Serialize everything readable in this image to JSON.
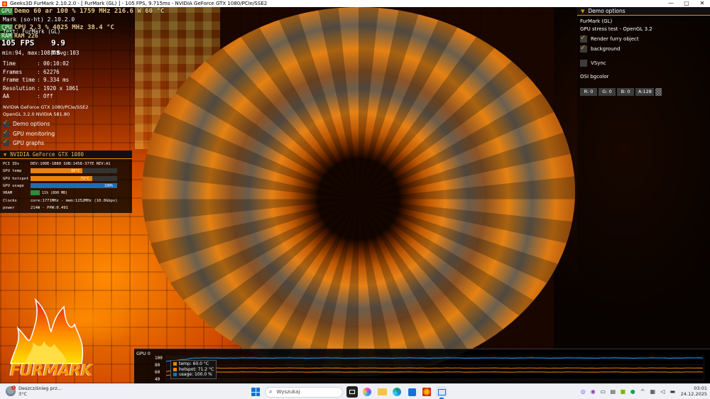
{
  "window": {
    "title": "Geeks3D FurMark 2.10.2.0 - [ FurMark (GL) ] - 105 FPS, 9.715ms - NVIDIA GeForce GTX 1080/PCIe/SSE2",
    "minimize": "—",
    "maximize": "▢",
    "close": "✕"
  },
  "osd": {
    "line1": "Demo 60 ar  100 %  1759 MHz 216.6 W   60 °C",
    "line2": "Mark (so-ht) 2.10.2.0",
    "line3": "CPU  2.3 %  4025 MHz  38.4 °C",
    "line4": "Test: FurMark (GL)",
    "ram": "RAM 226",
    "badge_gpu": "GPU",
    "badge_cpu": "CPU",
    "badge_ram": "RAM",
    "fps": "105 FPS",
    "frame_ms": "9.9 ms",
    "minmax": "min:94, max:108, avg:103"
  },
  "stats": [
    {
      "k": "Time",
      "v": ": 00:10:02"
    },
    {
      "k": "Frames",
      "v": ": 62276"
    },
    {
      "k": "Frame time",
      "v": ": 9.334 ms"
    },
    {
      "k": "Resolution",
      "v": ": 1920 x 1061"
    },
    {
      "k": "AA",
      "v": ": Off"
    }
  ],
  "gpu_info": {
    "renderer": "NVIDIA GeForce GTX 1080/PCIe/SSE2",
    "opengl": "OpenGL 3.2.0 NVIDIA 581.80"
  },
  "left_options": [
    {
      "label": "Demo options",
      "checked": true
    },
    {
      "label": "GPU monitoring",
      "checked": true
    },
    {
      "label": "GPU graphs",
      "checked": true
    }
  ],
  "gpu_panel": {
    "title": "NVIDIA GeForce GTX 1080",
    "pci_label": "PCI IDs",
    "pci_value": "DEV:10DE-1B80 SUB:1458-377E REV:A1",
    "temp_label": "GPU temp",
    "temp_value": "60°C",
    "temp_frac": 0.6,
    "hotspot_label": "GPU hotspot",
    "hotspot_value": "71°C",
    "hotspot_frac": 0.71,
    "usage_label": "GPU usage",
    "usage_value": "100%",
    "usage_frac": 1.0,
    "vram_label": "VRAM",
    "vram_value": "11% (890 MB)",
    "vram_frac": 0.11,
    "clocks_label": "Clocks",
    "clocks_value": "core:1771MHz - mem:1252MHz (10.0Gbps)",
    "power_label": "power",
    "power_value": "214W - PPW:0.491",
    "colors": {
      "temp": "#e8830c",
      "hotspot": "#e8830c",
      "usage": "#1a6fb5",
      "vram": "#2e8b3a"
    }
  },
  "logo": {
    "text": "FURMARK"
  },
  "demo_options": {
    "title": "Demo options",
    "demo_name": "FurMark (GL)",
    "demo_desc": "GPU stress test - OpenGL 3.2",
    "render_furry": {
      "label": "Render furry object",
      "checked": true
    },
    "background": {
      "label": "background",
      "checked": true
    },
    "vsync": {
      "label": "VSync",
      "checked": false
    },
    "osi_label": "OSI bgcolor",
    "r": "R: 0",
    "g": "G: 0",
    "b": "B: 0",
    "a": "A:128"
  },
  "graph": {
    "title": "GPU 0",
    "y_ticks": [
      "100",
      "80",
      "60",
      "40"
    ],
    "legend": [
      {
        "label": "temp: 60.0 °C",
        "color": "#e8830c"
      },
      {
        "label": "hotspot: 71.2 °C",
        "color": "#e8830c"
      },
      {
        "label": "usage: 100.0 %",
        "color": "#1a6fb5"
      }
    ]
  },
  "taskbar": {
    "weather_line1": "Deszcz/śnieg prz...",
    "weather_line2": "3°C",
    "weather_badge": "1",
    "search_placeholder": "Wyszukaj",
    "time": "03:01",
    "date": "24.12.2025",
    "chevron": "^"
  }
}
